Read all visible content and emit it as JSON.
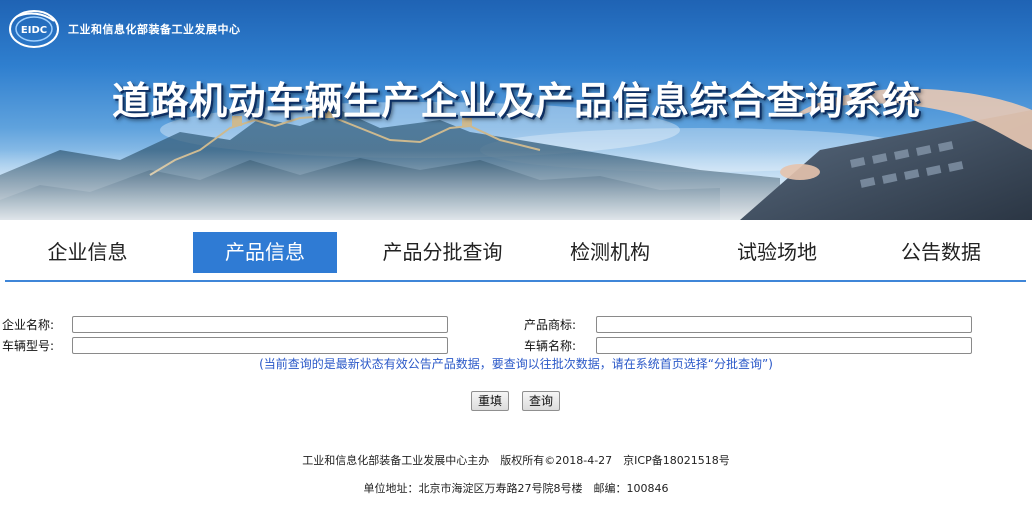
{
  "header": {
    "org_name": "工业和信息化部装备工业发展中心",
    "logo_text": "EIDC",
    "site_title": "道路机动车辆生产企业及产品信息综合查询系统"
  },
  "nav": {
    "items": [
      {
        "label": "企业信息",
        "active": false
      },
      {
        "label": "产品信息",
        "active": true
      },
      {
        "label": "产品分批查询",
        "active": false
      },
      {
        "label": "检测机构",
        "active": false
      },
      {
        "label": "试验场地",
        "active": false
      },
      {
        "label": "公告数据",
        "active": false
      }
    ]
  },
  "form": {
    "company_name_label": "企业名称:",
    "company_name_value": "",
    "brand_label": "产品商标:",
    "brand_value": "",
    "model_label": "车辆型号:",
    "model_value": "",
    "vehicle_name_label": "车辆名称:",
    "vehicle_name_value": "",
    "note": "(当前查询的是最新状态有效公告产品数据，要查询以往批次数据，请在系统首页选择“分批查询”)",
    "reset_label": "重填",
    "search_label": "查询"
  },
  "footer": {
    "line1": "工业和信息化部装备工业发展中心主办　版权所有©2018-4-27　京ICP备18021518号",
    "line2": "单位地址：北京市海淀区万寿路27号院8号楼　邮编：100846"
  },
  "colors": {
    "accent": "#2f7bd4",
    "note_text": "#2a58c8",
    "banner_sky": "#2f7fcf"
  }
}
